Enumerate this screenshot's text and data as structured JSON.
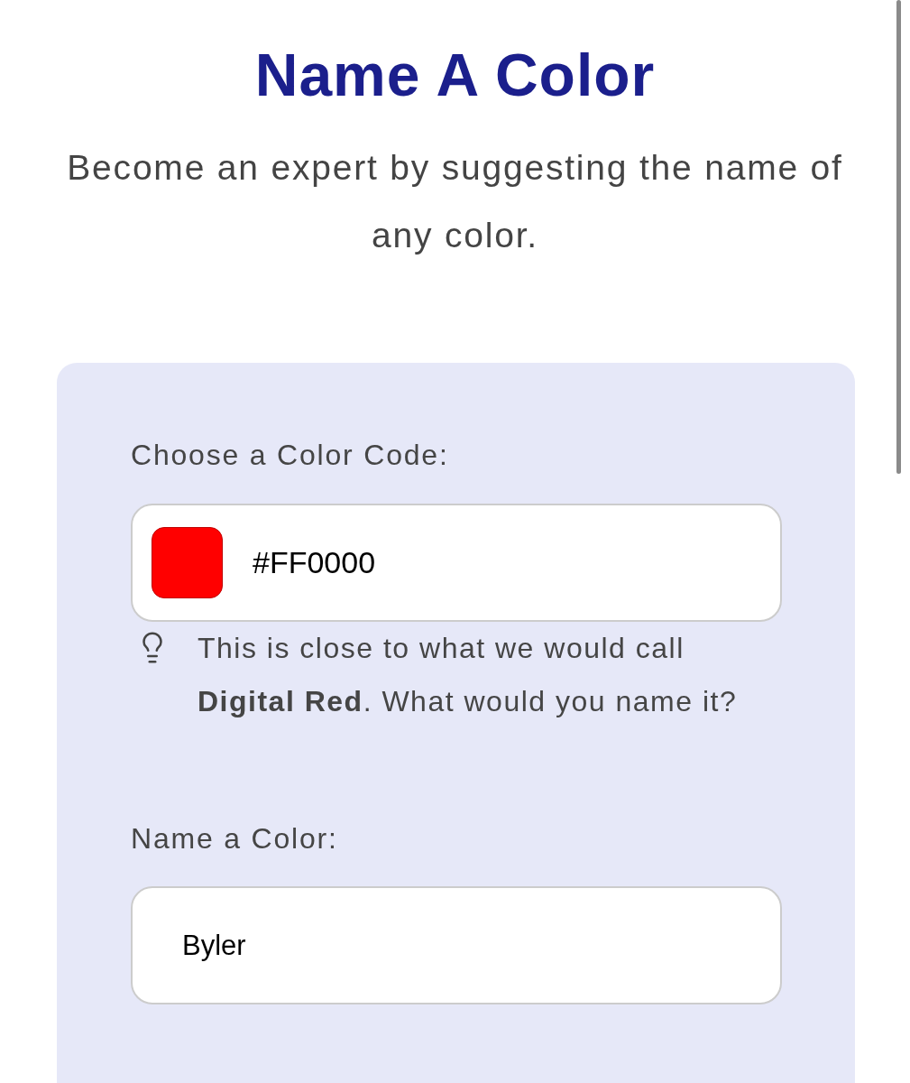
{
  "page": {
    "title": "Name A Color",
    "subtitle": "Become an expert by suggesting the name of any color."
  },
  "form": {
    "color_code": {
      "label": "Choose a Color Code:",
      "value": "#FF0000",
      "color": "#ff0000"
    },
    "hint": "This is close to what we would call **Digital Red**. What would you name it?",
    "name_field": {
      "label": "Name a Color:",
      "value": "Byler"
    }
  }
}
